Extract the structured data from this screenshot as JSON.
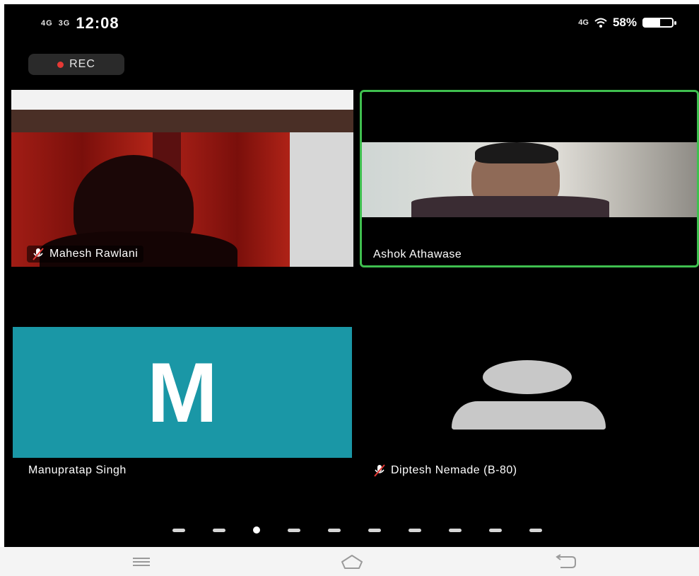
{
  "status_bar": {
    "time": "12:08",
    "left_small_1": "4G",
    "left_small_2": "3G",
    "battery_percent": "58%",
    "battery_level": 0.58,
    "network": "4G"
  },
  "recording": {
    "label": "REC",
    "dot_color": "#e53935"
  },
  "participants": [
    {
      "name": "Mahesh Rawlani",
      "muted": true,
      "video_on": true
    },
    {
      "name": "Ashok Athawase",
      "muted": false,
      "video_on": true,
      "active_speaker": true,
      "highlight_color": "#3fbf4f"
    },
    {
      "name": "Manupratap Singh",
      "muted": false,
      "video_on": false,
      "avatar_initial": "M",
      "avatar_color": "#1a97a6"
    },
    {
      "name": "Diptesh Nemade (B-80)",
      "muted": true,
      "video_on": false,
      "avatar_type": "default-silhouette"
    }
  ],
  "pagination": {
    "total": 10,
    "active_index": 2
  },
  "nav_bar": {
    "buttons": [
      "menu-icon",
      "home-icon",
      "back-icon"
    ]
  }
}
